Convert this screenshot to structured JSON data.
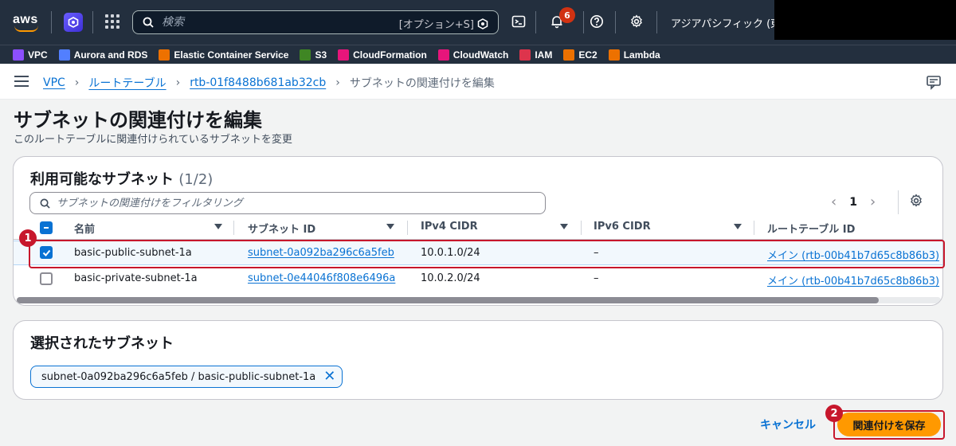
{
  "topnav": {
    "logo_text": "aws",
    "search_placeholder": "検索",
    "search_shortcut": "[オプション+S]",
    "notification_count": "6",
    "region": "アジアパシフィック (東京)"
  },
  "favorites": [
    {
      "label": "VPC",
      "color": "#8c4fff"
    },
    {
      "label": "Aurora and RDS",
      "color": "#527fff"
    },
    {
      "label": "Elastic Container Service",
      "color": "#ed7100"
    },
    {
      "label": "S3",
      "color": "#3f8624"
    },
    {
      "label": "CloudFormation",
      "color": "#e7157b"
    },
    {
      "label": "CloudWatch",
      "color": "#e7157b"
    },
    {
      "label": "IAM",
      "color": "#dd344c"
    },
    {
      "label": "EC2",
      "color": "#ed7100"
    },
    {
      "label": "Lambda",
      "color": "#ed7100"
    }
  ],
  "breadcrumb": {
    "items": [
      "VPC",
      "ルートテーブル",
      "rtb-01f8488b681ab32cb"
    ],
    "current": "サブネットの関連付けを編集"
  },
  "page": {
    "title": "サブネットの関連付けを編集",
    "description": "このルートテーブルに関連付けられているサブネットを変更"
  },
  "available": {
    "heading": "利用可能なサブネット",
    "count": "(1/2)",
    "filter_placeholder": "サブネットの関連付けをフィルタリング",
    "page": "1",
    "columns": [
      "名前",
      "サブネット ID",
      "IPv4 CIDR",
      "IPv6 CIDR",
      "ルートテーブル ID"
    ],
    "rows": [
      {
        "name": "basic-public-subnet-1a",
        "subnet_id": "subnet-0a092ba296c6a5feb",
        "ipv4": "10.0.1.0/24",
        "ipv6": "–",
        "route_table": "メイン (rtb-00b41b7d65c8b86b3)",
        "selected": true
      },
      {
        "name": "basic-private-subnet-1a",
        "subnet_id": "subnet-0e44046f808e6496a",
        "ipv4": "10.0.2.0/24",
        "ipv6": "–",
        "route_table": "メイン (rtb-00b41b7d65c8b86b3)",
        "selected": false
      }
    ]
  },
  "selected": {
    "heading": "選択されたサブネット",
    "token": "subnet-0a092ba296c6a5feb / basic-public-subnet-1a"
  },
  "actions": {
    "cancel": "キャンセル",
    "save": "関連付けを保存"
  },
  "annotations": {
    "step1": "1",
    "step2": "2",
    "color": "#c7172c"
  }
}
